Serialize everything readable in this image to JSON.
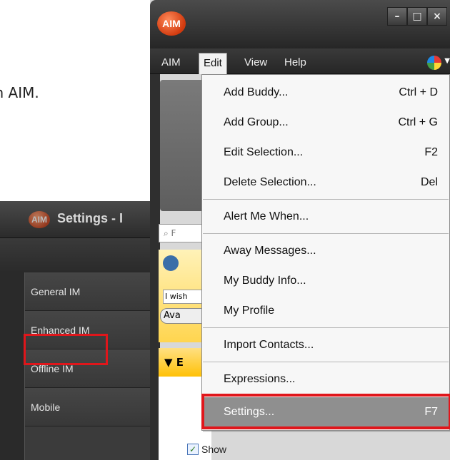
{
  "background_text": "ct it in AIM.",
  "settings_window": {
    "logo": "AIM",
    "title": "Settings - I",
    "nav_items": [
      "General IM",
      "Enhanced IM",
      "Offline IM",
      "Mobile"
    ]
  },
  "aim_window": {
    "logo": "AIM",
    "window_buttons": [
      "–",
      "□",
      "×"
    ],
    "menu": [
      "AIM",
      "Edit",
      "View",
      "Help"
    ],
    "search_placeholder": "F",
    "status_message": "I wish",
    "status_button": "Ava",
    "group_header": "▼ E",
    "show_label": "Show"
  },
  "edit_menu": {
    "items": [
      {
        "label": "Add Buddy...",
        "shortcut": "Ctrl + D"
      },
      {
        "label": "Add Group...",
        "shortcut": "Ctrl + G"
      },
      {
        "label": "Edit Selection...",
        "shortcut": "F2"
      },
      {
        "label": "Delete Selection...",
        "shortcut": "Del"
      },
      {
        "label": "Alert Me When...",
        "shortcut": ""
      },
      {
        "label": "Away Messages...",
        "shortcut": ""
      },
      {
        "label": "My Buddy Info...",
        "shortcut": ""
      },
      {
        "label": "My Profile",
        "shortcut": ""
      },
      {
        "label": "Import Contacts...",
        "shortcut": ""
      },
      {
        "label": "Expressions...",
        "shortcut": ""
      },
      {
        "label": "Settings...",
        "shortcut": "F7"
      }
    ]
  },
  "colors": {
    "highlight_box": "#e0161b",
    "selected_item": "#8f8f8f"
  }
}
